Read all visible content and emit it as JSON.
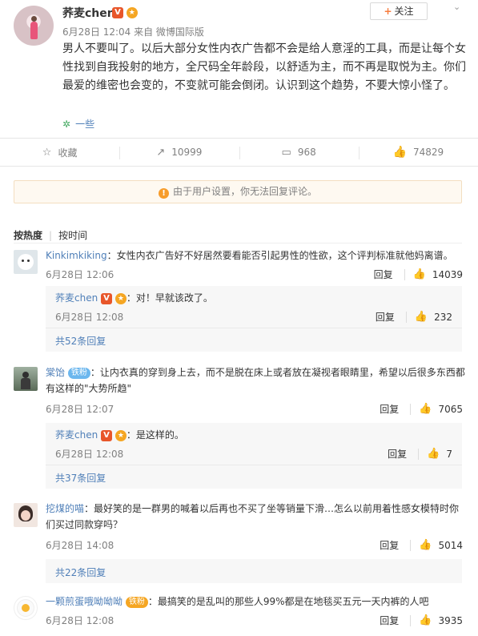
{
  "post": {
    "author": "荞麦chen",
    "meta": "6月28日 12:04 来自 微博国际版",
    "follow_label": "关注",
    "text": "男人不要叫了。以后大部分女性内衣广告都不会是给人意淫的工具，而是让每个女性找到自我投射的地方，全尺码全年龄段，以舒适为主，而不再是取悦为主。你们最爱的维密也会变的，不变就可能会倒闭。认识到这个趋势，不要大惊小怪了。",
    "source": "一些"
  },
  "actions": {
    "favorite": "收藏",
    "repost": "10999",
    "comment": "968",
    "like": "74829"
  },
  "notice": "由于用户设置，你无法回复评论。",
  "sort": {
    "hot": "按热度",
    "time": "按时间"
  },
  "comments": [
    {
      "name": "Kinkimkiking",
      "text": "：女性内衣广告好不好居然要看能否引起男性的性欲，这个评判标准就他妈离谱。",
      "time": "6月28日 12:06",
      "reply_label": "回复",
      "likes": "14039",
      "sub": {
        "name": "荞麦chen",
        "text": "：对！早就该改了。",
        "time": "6月28日 12:08",
        "reply_label": "回复",
        "likes": "232"
      },
      "more": "共52条回复"
    },
    {
      "name": "棠饴",
      "badge": "铁粉",
      "text": "：让内衣真的穿到身上去，而不是脱在床上或者放在凝视者眼睛里，希望以后很多东西都有这样的\"大势所趋\"",
      "time": "6月28日 12:07",
      "reply_label": "回复",
      "likes": "7065",
      "sub": {
        "name": "荞麦chen",
        "text": "：是这样的。",
        "time": "6月28日 12:08",
        "reply_label": "回复",
        "likes": "7"
      },
      "more": "共37条回复"
    },
    {
      "name": "挖煤的喵",
      "text": "：最好笑的是一群男的喊着以后再也不买了坐等销量下滑…怎么以前用着性感女模特时你们买过同款穿吗？",
      "time": "6月28日 14:08",
      "reply_label": "回复",
      "likes": "5014",
      "more": "共22条回复"
    },
    {
      "name": "一颗煎蛋哦呦呦呦",
      "badge": "铁粉",
      "text": "：最搞笑的是乱叫的那些人99%都是在地毯买五元一天内裤的人吧",
      "time": "6月28日 12:08",
      "reply_label": "回复",
      "likes": "3935"
    }
  ]
}
